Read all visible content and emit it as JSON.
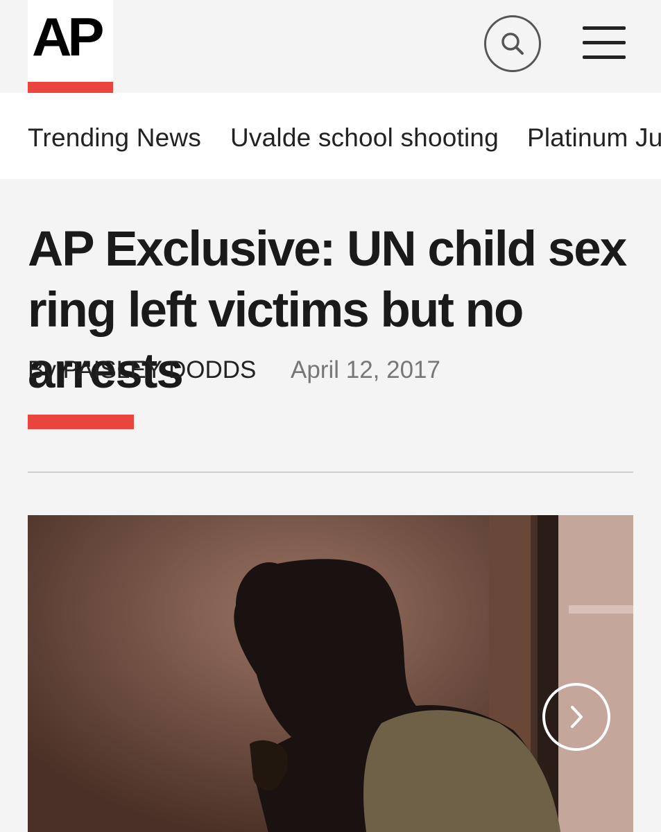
{
  "header": {
    "logo_text": "AP",
    "search_icon": "search-icon",
    "menu_icon": "hamburger-menu-icon",
    "brand_color": "#e9443d"
  },
  "trending": {
    "items": [
      {
        "label": "Trending News"
      },
      {
        "label": "Uvalde school shooting"
      },
      {
        "label": "Platinum Jul"
      }
    ]
  },
  "article": {
    "headline": "AP Exclusive: UN child sex ring left victims but no arrests",
    "byline": "By PAISLEY DODDS",
    "date": "April 12, 2017"
  },
  "gallery": {
    "next_icon": "chevron-right-icon"
  }
}
